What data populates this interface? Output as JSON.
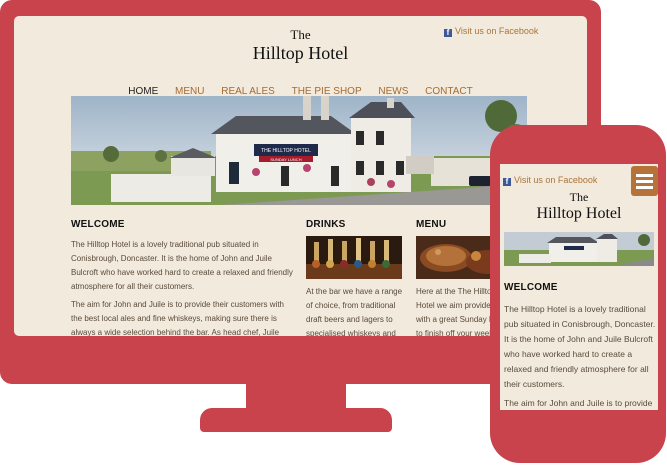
{
  "facebook_link": "Visit us on Facebook",
  "logo": {
    "line1": "The",
    "line2": "Hilltop Hotel"
  },
  "nav": [
    "HOME",
    "MENU",
    "REAL ALES",
    "THE PIE SHOP",
    "NEWS",
    "CONTACT"
  ],
  "active_nav": "HOME",
  "hero_sign": {
    "name": "THE HILLTOP HOTEL",
    "sub": "SUNDAY LUNCH"
  },
  "welcome": {
    "title": "WELCOME",
    "para1": "The Hilltop Hotel is a lovely traditional pub situated in Conisbrough, Doncaster. It is the home of John and Juile Bulcroft who have worked hard to create a relaxed and friendly atmosphere for all their customers.",
    "para2": "The aim for John and Juile is to provide their customers with the best local ales and fine whiskeys, making sure there is always a wide selection behind the bar. As head chef, Juile also"
  },
  "drinks": {
    "title": "DRINKS",
    "text": "At the bar we have a range of choice, from traditional draft beers and lagers to specialised whiskeys and"
  },
  "menu": {
    "title": "MENU",
    "text": "Here at the The Hilltop Hotel we aim provide you with a great Sunday Lunch to finish off your week"
  },
  "mobile": {
    "welcome_title": "WELCOME",
    "para1": "The Hilltop Hotel is a lovely traditional pub situated in Conisbrough, Doncaster. It is the home of John and Juile Bulcroft who have worked hard to create a relaxed and friendly atmosphere for all their customers.",
    "para2": "The aim for John and Juile is to provide"
  },
  "colors": {
    "frame": "#c8434b",
    "page_bg": "#f2ebdd",
    "link": "#a66a30",
    "menu_button": "#b5733a",
    "facebook_blue": "#3b5998"
  }
}
